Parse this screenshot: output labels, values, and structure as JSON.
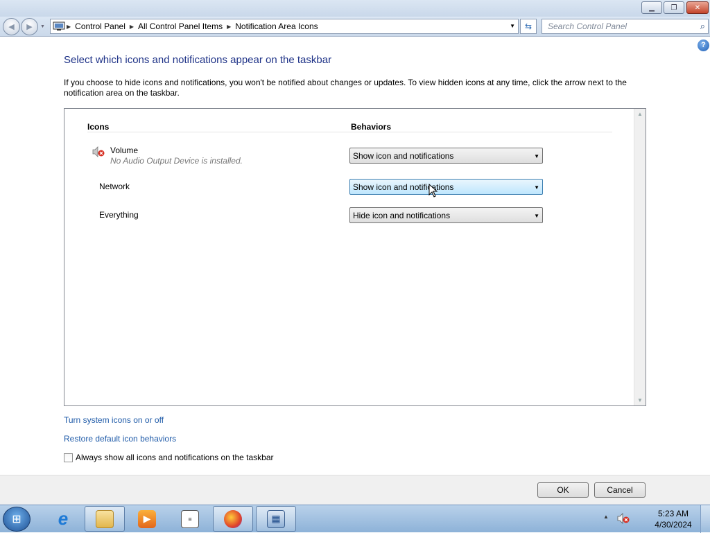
{
  "window": {
    "minimize_glyph": "▁",
    "maximize_glyph": "❐",
    "close_glyph": "✕"
  },
  "nav": {
    "back_glyph": "◀",
    "forward_glyph": "▶",
    "breadcrumb": [
      "Control Panel",
      "All Control Panel Items",
      "Notification Area Icons"
    ],
    "search_placeholder": "Search Control Panel"
  },
  "page": {
    "title": "Select which icons and notifications appear on the taskbar",
    "description": "If you choose to hide icons and notifications, you won't be notified about changes or updates. To view hidden icons at any time, click the arrow next to the notification area on the taskbar.",
    "help_glyph": "?"
  },
  "table": {
    "col_icons": "Icons",
    "col_behaviors": "Behaviors",
    "rows": [
      {
        "name": "Volume",
        "subtitle": "No Audio Output Device is installed.",
        "behavior": "Show icon and notifications",
        "icon": "speaker-muted-icon"
      },
      {
        "name": "Network",
        "subtitle": "",
        "behavior": "Show icon and notifications",
        "icon": ""
      },
      {
        "name": "Everything",
        "subtitle": "",
        "behavior": "Hide icon and notifications",
        "icon": ""
      }
    ]
  },
  "links": {
    "system_icons": "Turn system icons on or off",
    "restore_defaults": "Restore default icon behaviors"
  },
  "checkbox": {
    "label": "Always show all icons and notifications on the taskbar",
    "checked": false
  },
  "buttons": {
    "ok": "OK",
    "cancel": "Cancel"
  },
  "taskbar": {
    "time": "5:23 AM",
    "date": "4/30/2024",
    "apps": [
      "internet-explorer-icon",
      "file-explorer-icon",
      "media-player-icon",
      "text-editor-icon",
      "firefox-icon",
      "control-panel-icon"
    ]
  },
  "colors": {
    "heading": "#1e3287",
    "link": "#1e5aa8",
    "active_dropdown": "#bee6fd"
  }
}
